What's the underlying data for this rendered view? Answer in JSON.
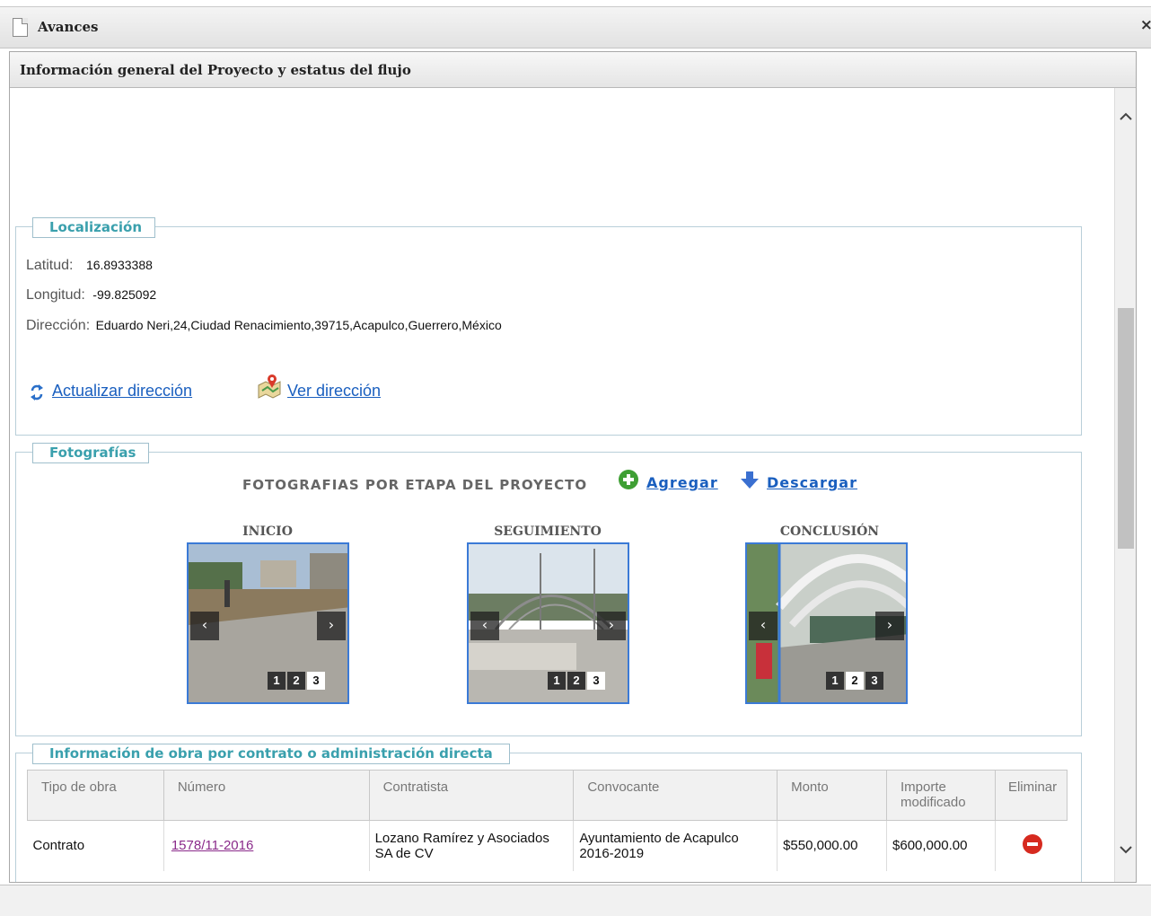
{
  "window": {
    "title": "Avances",
    "close_glyph": "×"
  },
  "panel": {
    "title": "Información general del Proyecto y estatus del flujo"
  },
  "location": {
    "legend": "Localización",
    "lat_label": "Latitud:",
    "lat_value": "16.8933388",
    "lng_label": "Longitud:",
    "lng_value": "-99.825092",
    "addr_label": "Dirección:",
    "addr_value": "Eduardo Neri,24,Ciudad Renacimiento,39715,Acapulco,Guerrero,México",
    "update_link": "Actualizar dirección",
    "view_link": "Ver dirección"
  },
  "photos": {
    "legend": "Fotografías",
    "heading": "FOTOGRAFIAS POR ETAPA DEL PROYECTO",
    "add_label": "Agregar",
    "download_label": "Descargar",
    "stages": [
      {
        "title": "INICIO",
        "pages": [
          "1",
          "2",
          "3"
        ],
        "active_page": 3
      },
      {
        "title": "SEGUIMIENTO",
        "pages": [
          "1",
          "2",
          "3"
        ],
        "active_page": 3
      },
      {
        "title": "CONCLUSIÓN",
        "pages": [
          "1",
          "2",
          "3"
        ],
        "active_page": 2
      }
    ],
    "prev_glyph": "‹",
    "next_glyph": "›"
  },
  "contract": {
    "legend": "Información de obra por contrato o administración directa",
    "columns": [
      "Tipo de obra",
      "Número",
      "Contratista",
      "Convocante",
      "Monto",
      "Importe modificado",
      "Eliminar"
    ],
    "rows": [
      {
        "tipo": "Contrato",
        "numero": "1578/11-2016",
        "contratista": "Lozano Ramírez y Asociados SA de CV",
        "convocante": "Ayuntamiento de Acapulco 2016-2019",
        "monto": "$550,000.00",
        "importe": "$600,000.00"
      }
    ]
  },
  "colors": {
    "accent": "#3aa0ad",
    "link": "#1a5fbf",
    "visited": "#8a2a8a",
    "delete": "#d62a1f",
    "active_frame": "#3b7ad6"
  },
  "icons": [
    "document-icon",
    "refresh-icon",
    "map-icon",
    "add-icon",
    "download-icon",
    "delete-icon",
    "scroll-up-icon",
    "scroll-down-icon"
  ]
}
